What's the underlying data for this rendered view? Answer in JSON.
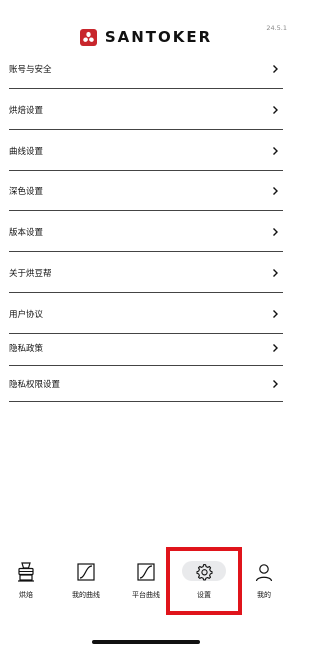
{
  "app": {
    "version": "24.5.1",
    "brand_name": "SANTOKER",
    "brand_color": "#c8262c"
  },
  "menu": {
    "items": [
      {
        "label": "账号与安全"
      },
      {
        "label": "烘焙设置"
      },
      {
        "label": "曲线设置"
      },
      {
        "label": "深色设置"
      },
      {
        "label": "版本设置"
      },
      {
        "label": "关于烘豆帮"
      },
      {
        "label": "用户协议"
      },
      {
        "label": "隐私政策"
      },
      {
        "label": "隐私权限设置"
      }
    ]
  },
  "tabbar": {
    "tabs": [
      {
        "label": "烘焙",
        "icon": "roaster-icon"
      },
      {
        "label": "我的曲线",
        "icon": "curve-icon"
      },
      {
        "label": "平台曲线",
        "icon": "curve-icon"
      },
      {
        "label": "设置",
        "icon": "gear-icon",
        "selected": true
      },
      {
        "label": "我的",
        "icon": "user-icon"
      }
    ]
  },
  "colors": {
    "highlight": "#e0141b"
  }
}
